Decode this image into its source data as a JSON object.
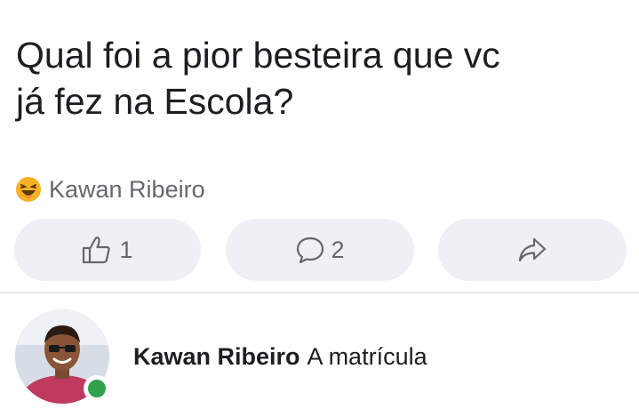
{
  "post": {
    "text_line1": "Qual foi a pior besteira que vc",
    "text_line2": "já fez na Escola?"
  },
  "reactions": {
    "icon": "haha-emoji-icon",
    "reactor_name": "Kawan Ribeiro"
  },
  "actions": {
    "like_count": "1",
    "comment_count": "2",
    "share_icon": "share-arrow-icon"
  },
  "comment": {
    "author": "Kawan Ribeiro",
    "text": "A matrícula",
    "online_status_color": "#31a24c"
  },
  "colors": {
    "button_bg": "#eef0f5",
    "secondary_text": "#65676b",
    "primary_text": "#1c1e21"
  }
}
